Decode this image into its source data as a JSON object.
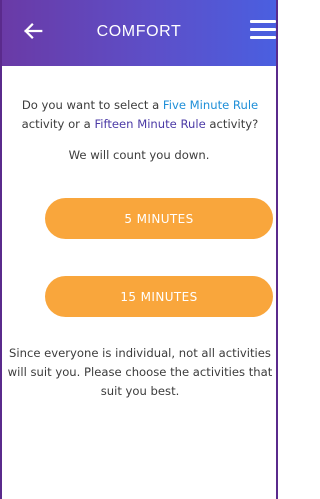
{
  "header": {
    "title": "COMFORT",
    "back_icon": "arrow-left-icon",
    "menu_icon": "hamburger-menu-icon",
    "gradient_colors": [
      "#6a3aa6",
      "#5d4fc8",
      "#4a5fe0"
    ]
  },
  "intro": {
    "part1": "Do you want to select a ",
    "link_five": "Five Minute Rule",
    "part2": " activity or a ",
    "link_fifteen": "Fifteen Minute Rule",
    "part3": " activity?"
  },
  "countdown_text": "We will count you down.",
  "buttons": {
    "five_minutes": "5 MINUTES",
    "fifteen_minutes": "15 MINUTES"
  },
  "footer_text": "Since everyone is individual, not all activities will suit you. Please choose the activities that suit you best.",
  "colors": {
    "accent_orange": "#f9a63c",
    "link_blue": "#1f8fd8",
    "link_purple": "#4b3aa6",
    "body_text": "#3c3c3c"
  }
}
